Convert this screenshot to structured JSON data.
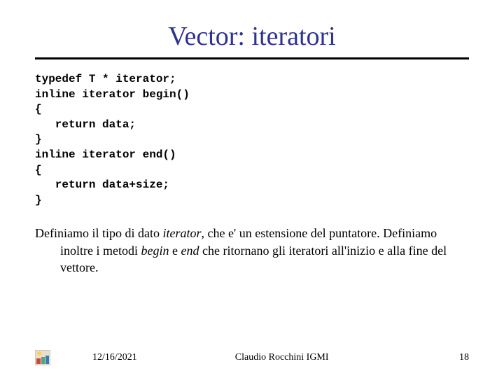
{
  "title": "Vector: iteratori",
  "code": "typedef T * iterator;\ninline iterator begin()\n{\n   return data;\n}\ninline iterator end()\n{\n   return data+size;\n}",
  "desc_prefix": "Definiamo il tipo di dato ",
  "desc_em1": "iterator",
  "desc_mid1": ", che e' un estensione del puntatore. Definiamo inoltre i metodi ",
  "desc_em2": "begin",
  "desc_mid2": " e ",
  "desc_em3": "end",
  "desc_suffix": " che ritornano gli iteratori all'inizio e alla fine del vettore.",
  "footer": {
    "date": "12/16/2021",
    "author": "Claudio Rocchini IGMI",
    "page": "18"
  }
}
